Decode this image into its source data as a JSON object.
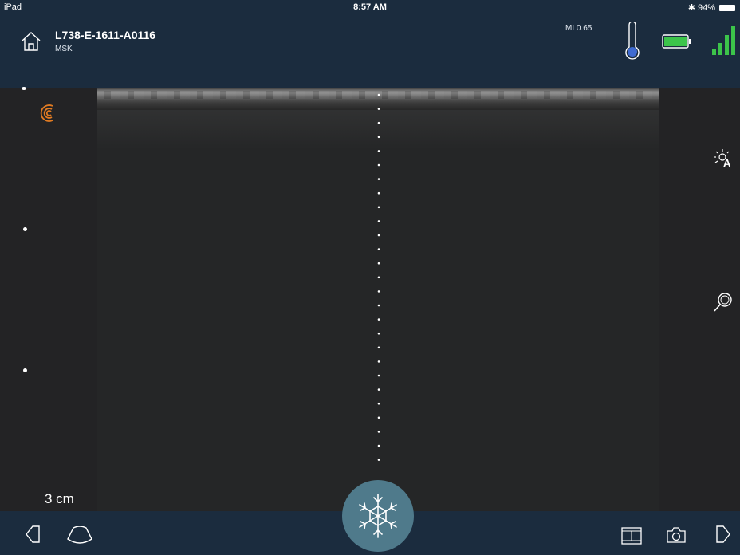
{
  "status_bar": {
    "device": "iPad",
    "time": "8:57 AM",
    "bluetooth": "bluetooth-icon",
    "battery_pct": "94%"
  },
  "header": {
    "probe_id": "L738-E-1611-A0116",
    "preset": "MSK",
    "mi": "MI 0.65",
    "battery_level": 1.0,
    "signal_bars": 4
  },
  "image": {
    "depth": "3 cm"
  },
  "icons": {
    "home": "home-icon",
    "thermometer": "thermometer-icon",
    "battery": "battery-icon",
    "signal": "signal-icon",
    "orientation": "orientation-marker-icon",
    "auto_gain": "auto-gain-icon",
    "zoom": "zoom-icon",
    "back": "back-arrow-icon",
    "probe": "probe-shape-icon",
    "freeze": "snowflake-icon",
    "cine": "cine-film-icon",
    "camera": "camera-icon",
    "forward": "forward-arrow-icon"
  },
  "colors": {
    "bar": "#1b2c3e",
    "freeze": "#4f7a8b",
    "orientation": "#e07a22",
    "battery": "#3cc44a",
    "signal": "#3cc44a",
    "thermo": "#3f6bd1"
  }
}
